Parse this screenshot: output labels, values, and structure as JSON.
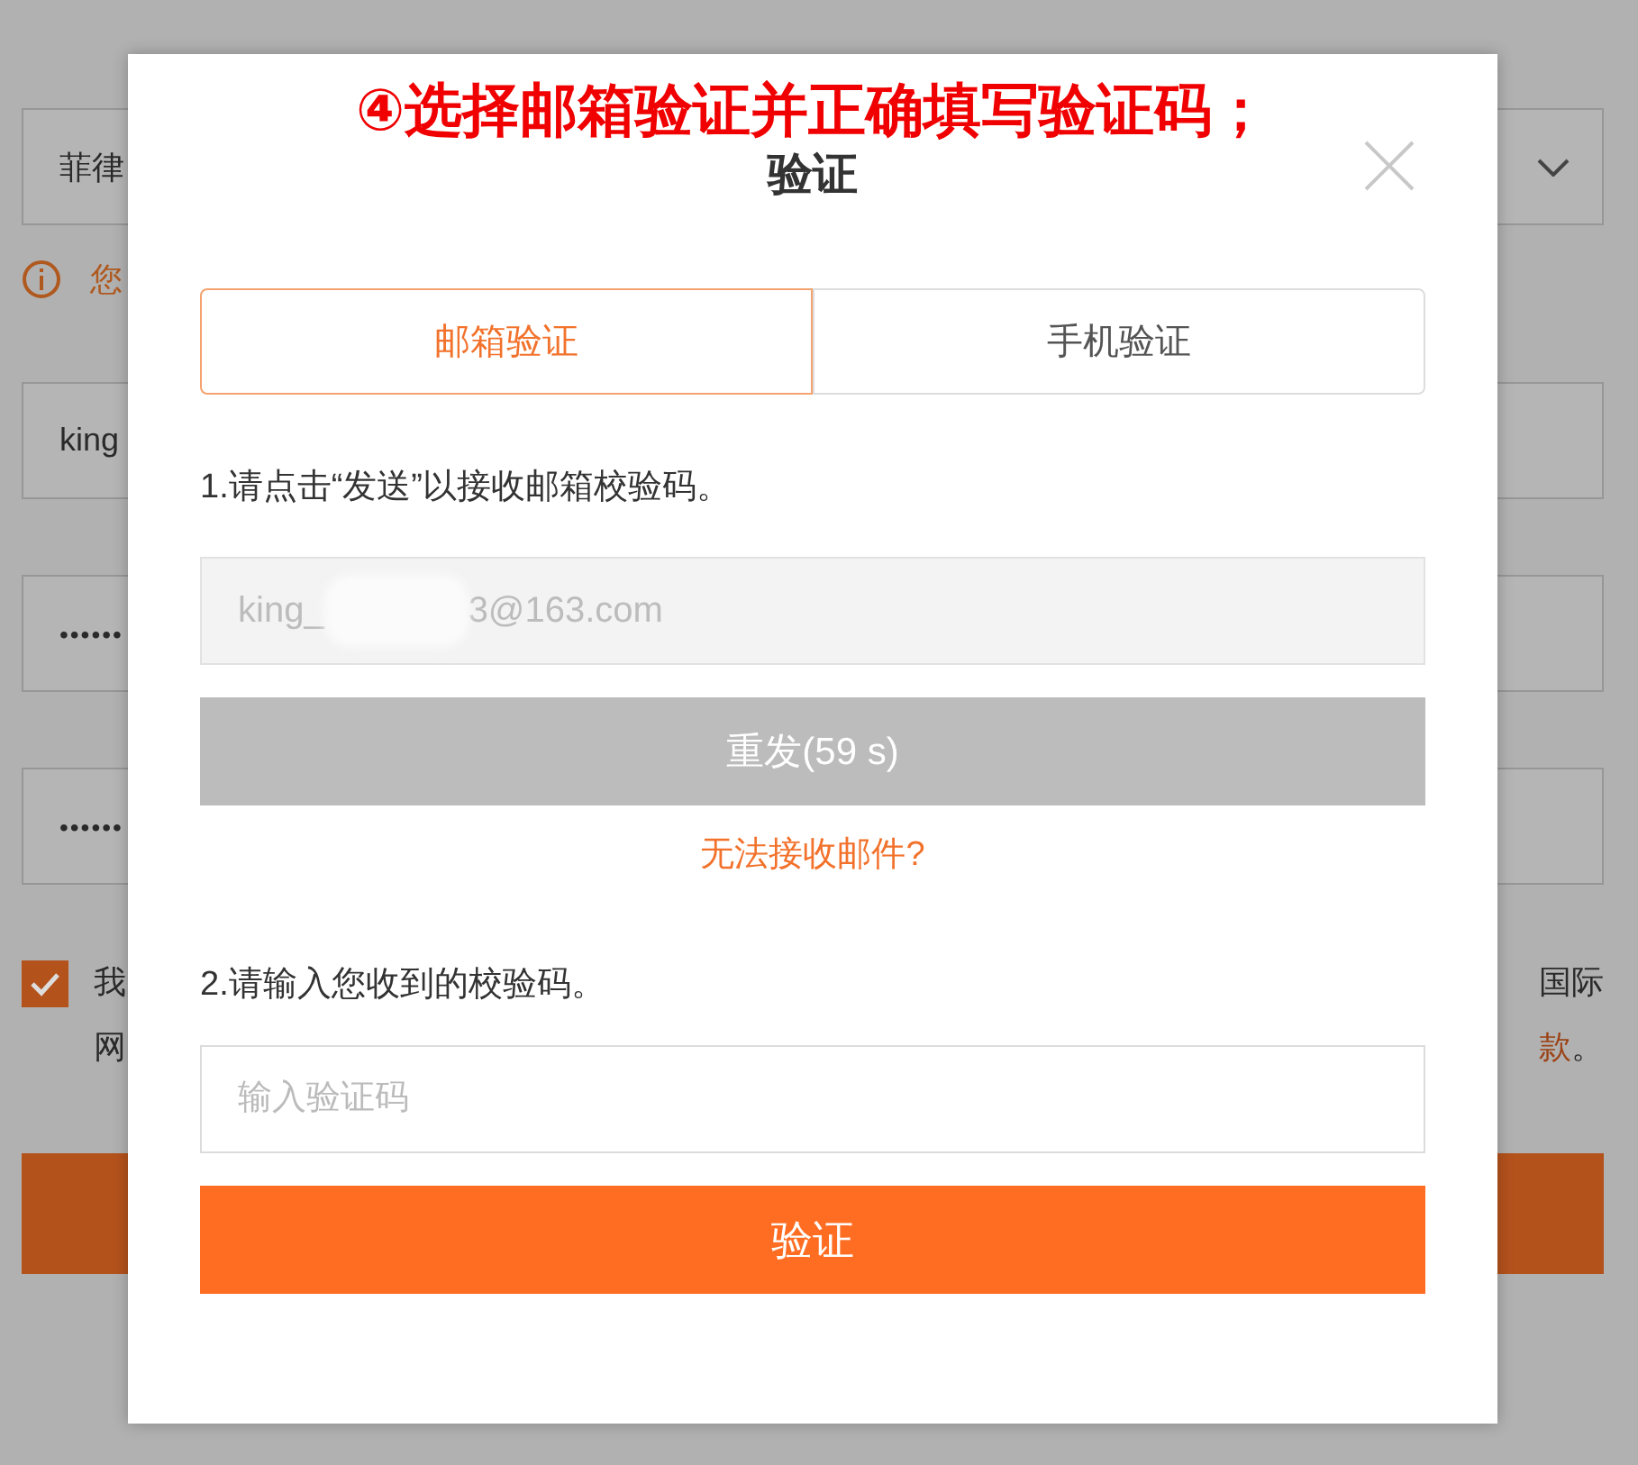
{
  "background": {
    "region_select": {
      "value": "菲律"
    },
    "notice": {
      "text": "您"
    },
    "account_field": {
      "value": "king"
    },
    "password_fields": [
      {
        "value": "••••••"
      },
      {
        "value": "••••••"
      }
    ],
    "agreement": {
      "checked": true,
      "left_lines": [
        "我",
        "网"
      ],
      "right_lines": [
        [
          {
            "text": "国际",
            "link": false
          }
        ],
        [
          {
            "text": "款",
            "link": true
          },
          {
            "text": "。",
            "link": false
          }
        ]
      ]
    }
  },
  "dialog": {
    "annotation": "④选择邮箱验证并正确填写验证码；",
    "title": "验证",
    "tabs": [
      {
        "label": "邮箱验证",
        "selected": true
      },
      {
        "label": "手机验证",
        "selected": false
      }
    ],
    "step_1": "1.请点击“发送”以接收邮箱校验码。",
    "email_field": {
      "value_start": "king_",
      "value_end": "3@163.com",
      "disabled": true
    },
    "resend_button": {
      "label": "重发(59 s)",
      "disabled": true
    },
    "help_link": "无法接收邮件?",
    "step_2": "2.请输入您收到的校验码。",
    "code_field": {
      "placeholder": "输入验证码"
    },
    "verify_button": {
      "label": "验证"
    }
  }
}
